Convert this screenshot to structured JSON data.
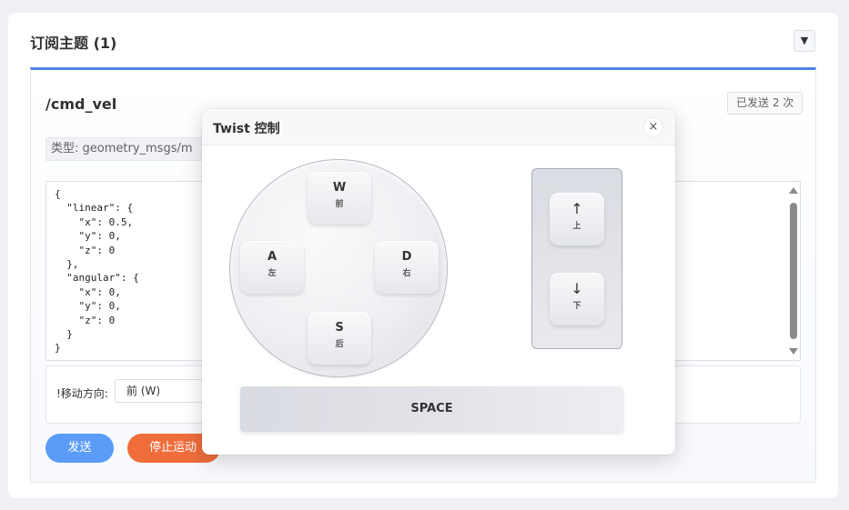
{
  "panel": {
    "title": "订阅主题 (1)",
    "collapse_icon": "▼"
  },
  "topic": {
    "name": "/cmd_vel",
    "sent_count": "已发送 2 次",
    "type_label": "类型: geometry_msgs/m",
    "message_json": "{\n  \"linear\": {\n    \"x\": 0.5,\n    \"y\": 0,\n    \"z\": 0\n  },\n  \"angular\": {\n    \"x\": 0,\n    \"y\": 0,\n    \"z\": 0\n  }\n}",
    "direction_label": "!移动方向:",
    "direction_value": "前 (W)",
    "send_label": "发送",
    "stop_label": "停止运动"
  },
  "dialog": {
    "title": "Twist 控制",
    "close_icon": "×",
    "keys": {
      "w": {
        "letter": "W",
        "sub": "前"
      },
      "a": {
        "letter": "A",
        "sub": "左"
      },
      "d": {
        "letter": "D",
        "sub": "右"
      },
      "s": {
        "letter": "S",
        "sub": "后"
      }
    },
    "vertical": {
      "up": {
        "arrow": "↑",
        "sub": "上"
      },
      "down": {
        "arrow": "↓",
        "sub": "下"
      }
    },
    "space_label": "SPACE"
  },
  "colors": {
    "accent": "#4e83ea",
    "send_button": "#5a9cf8",
    "stop_button": "#ef6d3b"
  }
}
